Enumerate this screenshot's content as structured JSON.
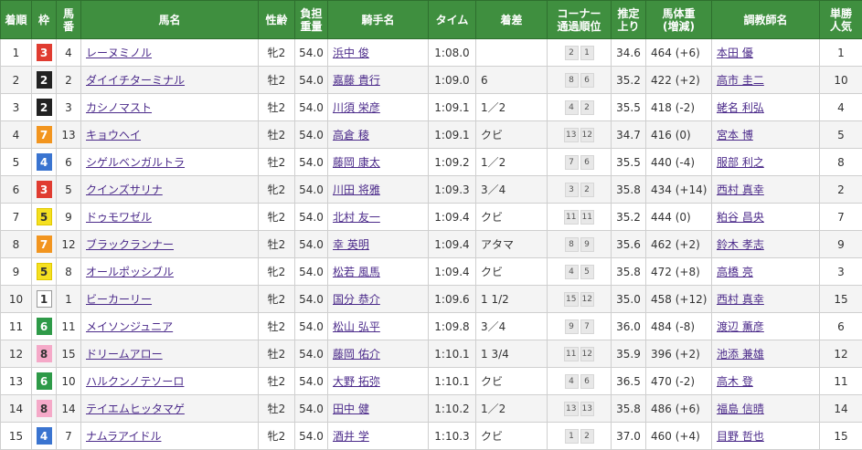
{
  "headers": [
    "着順",
    "枠",
    "馬番",
    "馬名",
    "性齢",
    "負担重量",
    "騎手名",
    "タイム",
    "着差",
    "コーナー通過順位",
    "推定上り",
    "馬体重(増減)",
    "調教師名",
    "単勝人気"
  ],
  "header_lines": {
    "umaban": [
      "馬",
      "番"
    ],
    "weight": [
      "負担",
      "重量"
    ],
    "corner": [
      "コーナー",
      "通過順位"
    ],
    "agari": [
      "推定",
      "上り"
    ],
    "bodyweight": [
      "馬体重",
      "(増減)"
    ],
    "ninki": [
      "単勝",
      "人気"
    ]
  },
  "waku_colors": {
    "1": {
      "bg": "#ffffff",
      "fg": "#333333",
      "border": "#999999"
    },
    "2": {
      "bg": "#222222",
      "fg": "#ffffff",
      "border": "#222222"
    },
    "3": {
      "bg": "#e03c31",
      "fg": "#ffffff",
      "border": "#e03c31"
    },
    "4": {
      "bg": "#3a74d0",
      "fg": "#ffffff",
      "border": "#3a74d0"
    },
    "5": {
      "bg": "#f5e021",
      "fg": "#333333",
      "border": "#e0c800"
    },
    "6": {
      "bg": "#2e9a48",
      "fg": "#ffffff",
      "border": "#2e9a48"
    },
    "7": {
      "bg": "#f2951f",
      "fg": "#ffffff",
      "border": "#f2951f"
    },
    "8": {
      "bg": "#f5a9c8",
      "fg": "#333333",
      "border": "#f5a9c8"
    }
  },
  "rows": [
    {
      "rank": "1",
      "waku": "3",
      "umaban": "4",
      "horse": "レーヌミノル",
      "sexage": "牝2",
      "weight": "54.0",
      "jockey": "浜中 俊",
      "time": "1:08.0",
      "margin": "",
      "corner": [
        "2",
        "1"
      ],
      "agari": "34.6",
      "bodyweight": "464 (+6)",
      "trainer": "本田 優",
      "ninki": "1"
    },
    {
      "rank": "2",
      "waku": "2",
      "umaban": "2",
      "horse": "ダイイチターミナル",
      "sexage": "牡2",
      "weight": "54.0",
      "jockey": "嘉藤 貴行",
      "time": "1:09.0",
      "margin": "6",
      "corner": [
        "8",
        "6"
      ],
      "agari": "35.2",
      "bodyweight": "422 (+2)",
      "trainer": "高市 圭二",
      "ninki": "10"
    },
    {
      "rank": "3",
      "waku": "2",
      "umaban": "3",
      "horse": "カシノマスト",
      "sexage": "牡2",
      "weight": "54.0",
      "jockey": "川須 栄彦",
      "time": "1:09.1",
      "margin": "1／2",
      "corner": [
        "4",
        "2"
      ],
      "agari": "35.5",
      "bodyweight": "418 (-2)",
      "trainer": "蛯名 利弘",
      "ninki": "4"
    },
    {
      "rank": "4",
      "waku": "7",
      "umaban": "13",
      "horse": "キョウヘイ",
      "sexage": "牡2",
      "weight": "54.0",
      "jockey": "高倉 稜",
      "time": "1:09.1",
      "margin": "クビ",
      "corner": [
        "13",
        "12"
      ],
      "agari": "34.7",
      "bodyweight": "416 (0)",
      "trainer": "宮本 博",
      "ninki": "5"
    },
    {
      "rank": "5",
      "waku": "4",
      "umaban": "6",
      "horse": "シゲルベンガルトラ",
      "sexage": "牡2",
      "weight": "54.0",
      "jockey": "藤岡 康太",
      "time": "1:09.2",
      "margin": "1／2",
      "corner": [
        "7",
        "6"
      ],
      "agari": "35.5",
      "bodyweight": "440 (-4)",
      "trainer": "服部 利之",
      "ninki": "8"
    },
    {
      "rank": "6",
      "waku": "3",
      "umaban": "5",
      "horse": "クインズサリナ",
      "sexage": "牝2",
      "weight": "54.0",
      "jockey": "川田 将雅",
      "time": "1:09.3",
      "margin": "3／4",
      "corner": [
        "3",
        "2"
      ],
      "agari": "35.8",
      "bodyweight": "434 (+14)",
      "trainer": "西村 真幸",
      "ninki": "2"
    },
    {
      "rank": "7",
      "waku": "5",
      "umaban": "9",
      "horse": "ドゥモワゼル",
      "sexage": "牝2",
      "weight": "54.0",
      "jockey": "北村 友一",
      "time": "1:09.4",
      "margin": "クビ",
      "corner": [
        "11",
        "11"
      ],
      "agari": "35.2",
      "bodyweight": "444 (0)",
      "trainer": "粕谷 昌央",
      "ninki": "7"
    },
    {
      "rank": "8",
      "waku": "7",
      "umaban": "12",
      "horse": "ブラックランナー",
      "sexage": "牡2",
      "weight": "54.0",
      "jockey": "幸 英明",
      "time": "1:09.4",
      "margin": "アタマ",
      "corner": [
        "8",
        "9"
      ],
      "agari": "35.6",
      "bodyweight": "462 (+2)",
      "trainer": "鈴木 孝志",
      "ninki": "9"
    },
    {
      "rank": "9",
      "waku": "5",
      "umaban": "8",
      "horse": "オールポッシブル",
      "sexage": "牝2",
      "weight": "54.0",
      "jockey": "松若 風馬",
      "time": "1:09.4",
      "margin": "クビ",
      "corner": [
        "4",
        "5"
      ],
      "agari": "35.8",
      "bodyweight": "472 (+8)",
      "trainer": "高橋 亮",
      "ninki": "3"
    },
    {
      "rank": "10",
      "waku": "1",
      "umaban": "1",
      "horse": "ビーカーリー",
      "sexage": "牝2",
      "weight": "54.0",
      "jockey": "国分 恭介",
      "time": "1:09.6",
      "margin": "1 1/2",
      "corner": [
        "15",
        "12"
      ],
      "agari": "35.0",
      "bodyweight": "458 (+12)",
      "trainer": "西村 真幸",
      "ninki": "15"
    },
    {
      "rank": "11",
      "waku": "6",
      "umaban": "11",
      "horse": "メイソンジュニア",
      "sexage": "牡2",
      "weight": "54.0",
      "jockey": "松山 弘平",
      "time": "1:09.8",
      "margin": "3／4",
      "corner": [
        "9",
        "7"
      ],
      "agari": "36.0",
      "bodyweight": "484 (-8)",
      "trainer": "渡辺 薫彦",
      "ninki": "6"
    },
    {
      "rank": "12",
      "waku": "8",
      "umaban": "15",
      "horse": "ドリームアロー",
      "sexage": "牡2",
      "weight": "54.0",
      "jockey": "藤岡 佑介",
      "time": "1:10.1",
      "margin": "1 3/4",
      "corner": [
        "11",
        "12"
      ],
      "agari": "35.9",
      "bodyweight": "396 (+2)",
      "trainer": "池添 兼雄",
      "ninki": "12"
    },
    {
      "rank": "13",
      "waku": "6",
      "umaban": "10",
      "horse": "ハルクンノテソーロ",
      "sexage": "牡2",
      "weight": "54.0",
      "jockey": "大野 拓弥",
      "time": "1:10.1",
      "margin": "クビ",
      "corner": [
        "4",
        "6"
      ],
      "agari": "36.5",
      "bodyweight": "470 (-2)",
      "trainer": "高木 登",
      "ninki": "11"
    },
    {
      "rank": "14",
      "waku": "8",
      "umaban": "14",
      "horse": "テイエムヒッタマゲ",
      "sexage": "牡2",
      "weight": "54.0",
      "jockey": "田中 健",
      "time": "1:10.2",
      "margin": "1／2",
      "corner": [
        "13",
        "13"
      ],
      "agari": "35.8",
      "bodyweight": "486 (+6)",
      "trainer": "福島 信晴",
      "ninki": "14"
    },
    {
      "rank": "15",
      "waku": "4",
      "umaban": "7",
      "horse": "ナムラアイドル",
      "sexage": "牝2",
      "weight": "54.0",
      "jockey": "酒井 学",
      "time": "1:10.3",
      "margin": "クビ",
      "corner": [
        "1",
        "2"
      ],
      "agari": "37.0",
      "bodyweight": "460 (+4)",
      "trainer": "目野 哲也",
      "ninki": "15"
    }
  ]
}
